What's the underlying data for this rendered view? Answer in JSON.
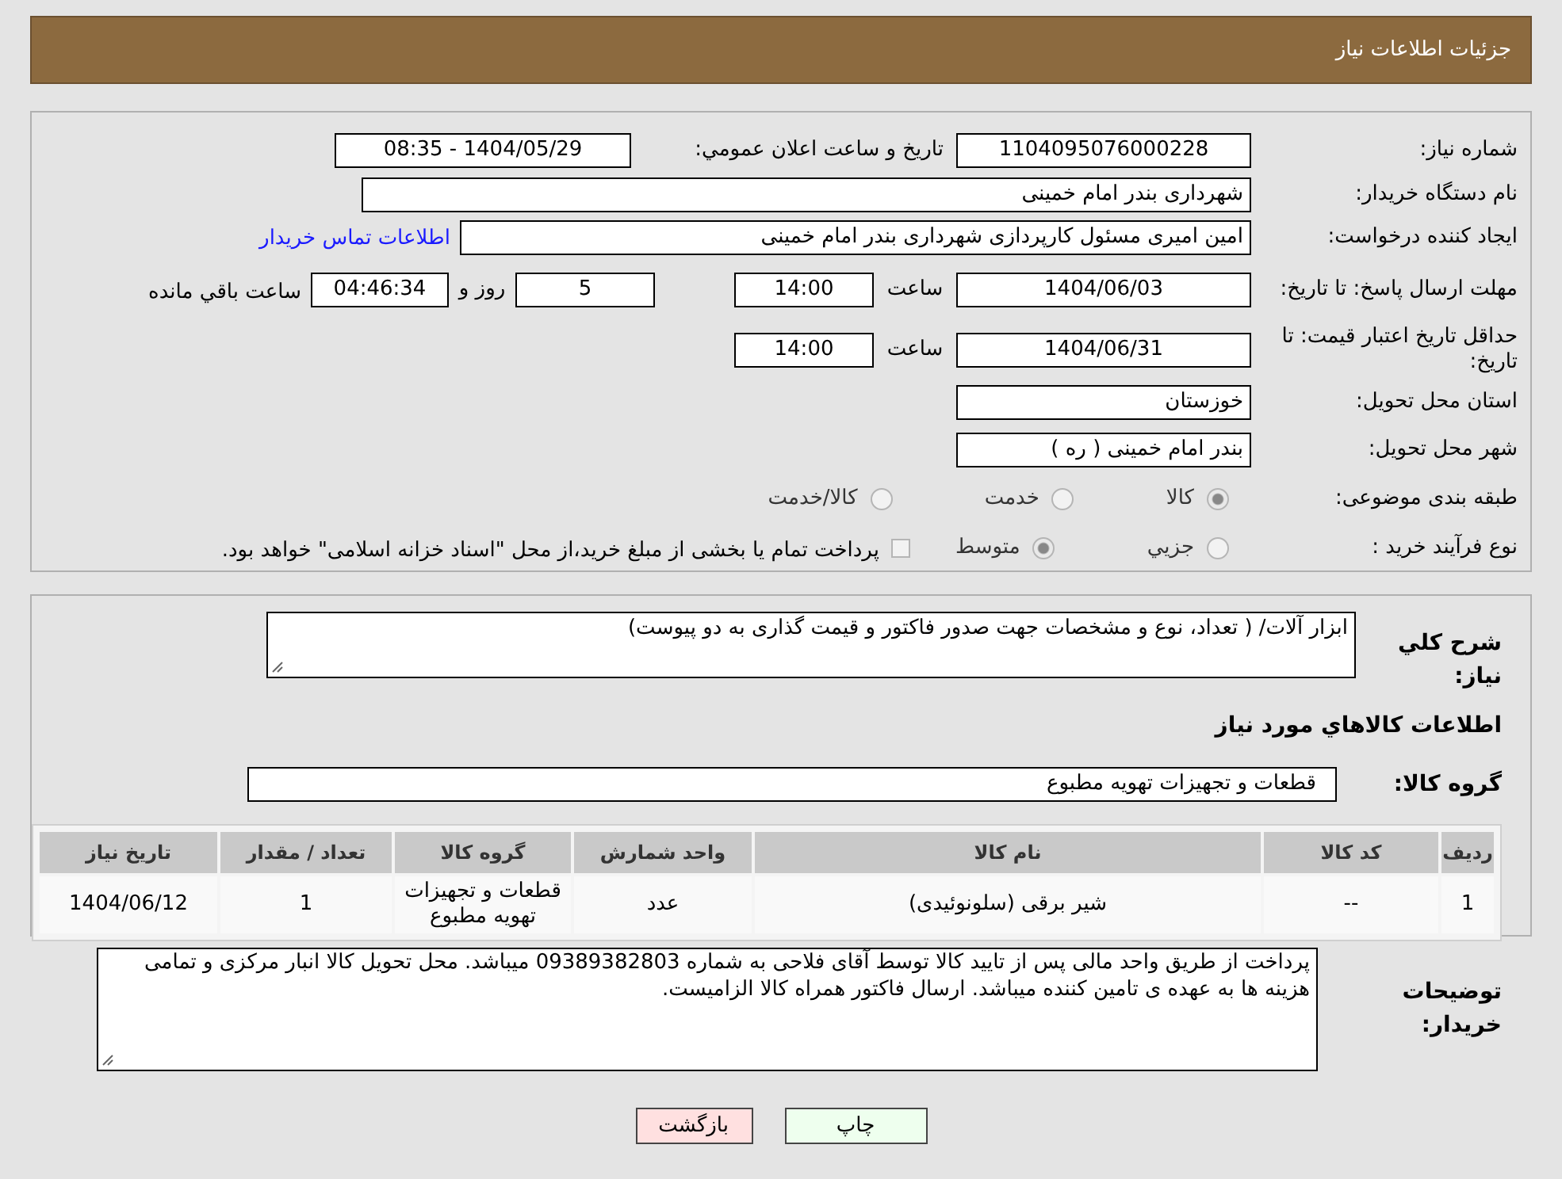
{
  "header": {
    "title": "جزئیات اطلاعات نیاز"
  },
  "need_number": {
    "label": "شماره نیاز:",
    "value": "1104095076000228"
  },
  "announce": {
    "label": "تاریخ و ساعت اعلان عمومي:",
    "value": "1404/05/29 - 08:35"
  },
  "buyer": {
    "label": "نام دستگاه خریدار:",
    "value": "شهرداری بندر امام خمینی"
  },
  "creator": {
    "label": "ایجاد کننده درخواست:",
    "value": "امین امیری مسئول کارپردازی شهرداری بندر امام خمینی",
    "link": "اطلاعات تماس خریدار"
  },
  "deadline": {
    "label": "مهلت ارسال پاسخ: تا تاریخ:",
    "date": "1404/06/03",
    "time_label": "ساعت",
    "time": "14:00",
    "days": "5",
    "days_label": "روز و",
    "remaining": "04:46:34",
    "remaining_label": "ساعت باقي مانده"
  },
  "validity": {
    "label": "حداقل تاریخ اعتبار قیمت: تا تاریخ:",
    "date": "1404/06/31",
    "time_label": "ساعت",
    "time": "14:00"
  },
  "province": {
    "label": "استان محل تحویل:",
    "value": "خوزستان"
  },
  "city": {
    "label": "شهر محل تحویل:",
    "value": "بندر امام خمینی ( ره )"
  },
  "category": {
    "label": "طبقه بندی موضوعی:",
    "options": [
      {
        "label": "کالا",
        "selected": true
      },
      {
        "label": "خدمت",
        "selected": false
      },
      {
        "label": "کالا/خدمت",
        "selected": false
      }
    ]
  },
  "purchase_type": {
    "label": "نوع فرآیند خرید :",
    "options": [
      {
        "label": "جزيي",
        "selected": false
      },
      {
        "label": "متوسط",
        "selected": true
      }
    ],
    "treasury": {
      "checked": false,
      "label": "پرداخت تمام يا بخشی از مبلغ خرید،از محل \"اسناد خزانه اسلامی\" خواهد بود."
    }
  },
  "summary": {
    "label": "شرح كلي نياز:",
    "value": "ابزار آلات/ ( تعداد، نوع و مشخصات جهت صدور فاکتور و قیمت گذاری به دو پیوست)"
  },
  "goods_heading": "اطلاعات كالاهاي مورد نياز",
  "goods_group": {
    "label": "گروه کالا:",
    "value": "قطعات و تجهیزات تهویه مطبوع"
  },
  "table": {
    "columns": [
      "ردیف",
      "کد کالا",
      "نام کالا",
      "واحد شمارش",
      "گروه کالا",
      "تعداد / مقدار",
      "تاریخ نیاز"
    ],
    "rows": [
      [
        "1",
        "--",
        "شیر برقی (سلونوئیدی)",
        "عدد",
        "قطعات و تجهیزات تهویه مطبوع",
        "1",
        "1404/06/12"
      ]
    ]
  },
  "buyer_notes": {
    "label": "توضیحات خریدار:",
    "value": "پرداخت از طریق واحد مالی پس از تایید کالا توسط آقای فلاحی به شماره 09389382803 میباشد. محل تحویل کالا انبار مرکزی و تمامی هزینه ها به عهده ی تامین کننده میباشد. ارسال فاکتور همراه کالا الزامیست."
  },
  "buttons": [
    {
      "label": "چاپ",
      "kind": "print"
    },
    {
      "label": "بازگشت",
      "kind": "back"
    }
  ]
}
